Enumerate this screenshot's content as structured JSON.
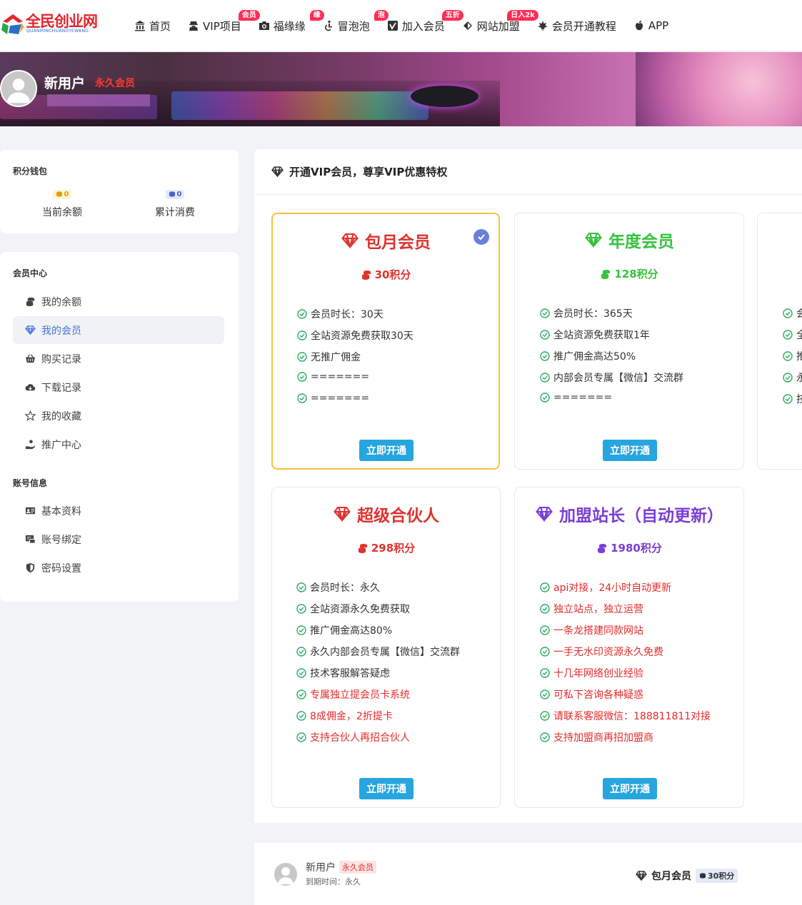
{
  "logo": {
    "title": "全民创业网",
    "subtitle": "QUANMINCHUANGYEWANG"
  },
  "nav": [
    {
      "label": "首页",
      "icon": "bank-icon",
      "badge": ""
    },
    {
      "label": "VIP项目",
      "icon": "user-secret-icon",
      "badge": "会员"
    },
    {
      "label": "福缘缘",
      "icon": "camera-icon",
      "badge": "缘"
    },
    {
      "label": "冒泡泡",
      "icon": "accessibility-icon",
      "badge": "泡"
    },
    {
      "label": "加入会员",
      "icon": "vimeo-icon",
      "badge": "五折"
    },
    {
      "label": "网站加盟",
      "icon": "delicious-icon",
      "badge": "日入2k"
    },
    {
      "label": "会员开通教程",
      "icon": "maple-leaf-icon",
      "badge": ""
    },
    {
      "label": "APP",
      "icon": "apple-icon",
      "badge": ""
    }
  ],
  "user": {
    "name": "新用户",
    "vip_label": "永久会员"
  },
  "wallet": {
    "title": "积分钱包",
    "balance_value": "0",
    "balance_label": "当前余额",
    "spent_value": "0",
    "spent_label": "累计消费"
  },
  "member_center": {
    "title": "会员中心",
    "items": [
      {
        "label": "我的余额",
        "icon": "coins-icon"
      },
      {
        "label": "我的会员",
        "icon": "diamond-icon"
      },
      {
        "label": "购买记录",
        "icon": "basket-icon"
      },
      {
        "label": "下载记录",
        "icon": "cloud-download-icon"
      },
      {
        "label": "我的收藏",
        "icon": "star-icon"
      },
      {
        "label": "推广中心",
        "icon": "hand-coin-icon"
      }
    ]
  },
  "account": {
    "title": "账号信息",
    "items": [
      {
        "label": "基本资料",
        "icon": "id-card-icon"
      },
      {
        "label": "账号绑定",
        "icon": "link-card-icon"
      },
      {
        "label": "密码设置",
        "icon": "shield-icon"
      }
    ]
  },
  "main": {
    "header": "开通VIP会员，尊享VIP优惠特权"
  },
  "plans": [
    {
      "title": "包月会员",
      "price": "30积分",
      "color": "#e0322f",
      "selected": true,
      "features": [
        "会员时长：30天",
        "全站资源免费获取30天",
        "无推广佣金",
        "=======",
        "======="
      ],
      "button": "立即开通"
    },
    {
      "title": "年度会员",
      "price": "128积分",
      "color": "#36c23c",
      "selected": false,
      "features": [
        "会员时长：365天",
        "全站资源免费获取1年",
        "推广佣金高达50%",
        "内部会员专属【微信】交流群",
        "======="
      ],
      "button": "立即开通"
    },
    {
      "title": "超级合伙人",
      "price": "298积分",
      "color": "#e0322f",
      "selected": false,
      "features": [
        "会员时长：永久",
        "全站资源永久免费获取",
        "推广佣金高达80%",
        "永久内部会员专属【微信】交流群",
        "技术客服解答疑虑",
        "专属独立提会员卡系统",
        "8成佣金，2折提卡",
        "支持合伙人再招合伙人"
      ],
      "button": "立即开通"
    },
    {
      "title": "加盟站长（自动更新）",
      "price": "1980积分",
      "color": "#7a3ed6",
      "selected": false,
      "features": [
        "api对接，24小时自动更新",
        "独立站点，独立运营",
        "一条龙搭建同款网站",
        "一手无水印资源永久免费",
        "十几年网络创业经验",
        "可私下咨询各种疑惑",
        "请联系客服微信：188811811对接",
        "支持加盟商再招加盟商"
      ],
      "button": "立即开通"
    }
  ],
  "partial_card": {
    "features_first_chars": [
      "会",
      "全",
      "推",
      "永",
      "技"
    ]
  },
  "footer": {
    "name": "新用户",
    "vip_badge": "永久会员",
    "expiry": "到期时间：永久",
    "plan_label": "包月会员",
    "plan_price": "30积分"
  }
}
